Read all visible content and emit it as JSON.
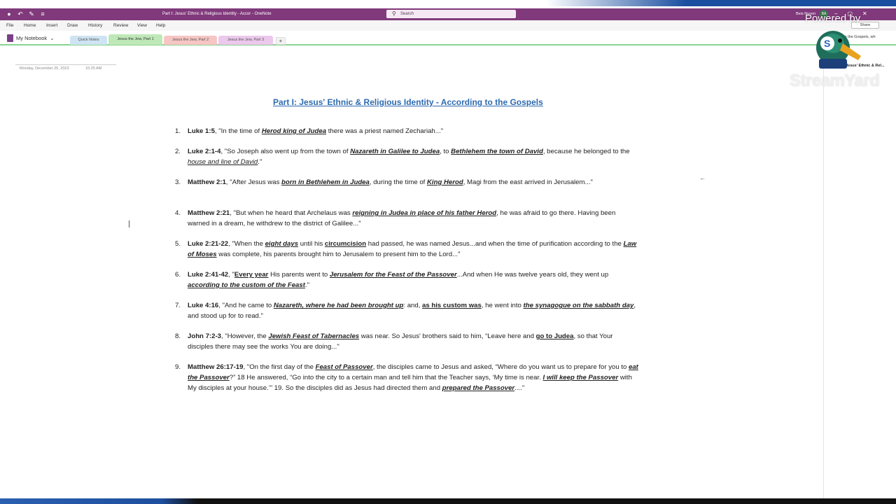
{
  "titlebar": {
    "title": "Part I: Jesus' Ethnic & Religious Identity - Accor  -  OneNote",
    "search_placeholder": "Search",
    "user_name": "Beis Nuvon",
    "user_initials": "BA"
  },
  "menu": [
    "File",
    "Home",
    "Insert",
    "Draw",
    "History",
    "Review",
    "View",
    "Help"
  ],
  "notebook": {
    "name": "My Notebook"
  },
  "section_tabs": [
    {
      "label": "Quick Notes",
      "color": "#cfe4f2"
    },
    {
      "label": "Jesus the Jew, Part 1",
      "color": "#bfe8b8"
    },
    {
      "label": "Jesus the Jew, Part 2",
      "color": "#f6c6c4"
    },
    {
      "label": "Jesus the Jew, Part 3",
      "color": "#ecc8ec"
    }
  ],
  "add_tab_label": "+",
  "page": {
    "date": "Monday, December 25, 2023",
    "time": "10:25 AM",
    "title": "Part I: Jesus' Ethnic & Religious Identity - According to the Gospels"
  },
  "entries": [
    {
      "num": "1.",
      "ref": "Luke 1:5",
      "t1": ", \"In the time of ",
      "e1": "Herod king of Judea",
      "t2": " there was a priest named Zechariah...\""
    },
    {
      "num": "2.",
      "ref": "Luke 2:1-4",
      "t1": ", \"So Joseph also went up from the town of ",
      "e1": "Nazareth in Galilee to Judea",
      "t2": ", to ",
      "e2": "Bethlehem the town of David",
      "t3": ", because he belonged to the ",
      "e3": "house and line of David",
      "t4": ".\""
    },
    {
      "num": "3.",
      "ref": "Matthew 2:1",
      "t1": ", \"After Jesus was ",
      "e1": "born in Bethlehem in Judea",
      "t2": ", during the time of ",
      "e2": "King Herod",
      "t3": ", Magi from the east arrived in Jerusalem...\""
    },
    {
      "num": "4.",
      "ref": "Matthew 2:21",
      "t1": ", \"But when he heard that Archelaus was ",
      "e1": "reigning in Judea in place of his father Herod",
      "t2": ", he was afraid to go there. Having been warned in a dream, he withdrew to the district of Galilee...\""
    },
    {
      "num": "5.",
      "ref": "Luke 2:21-22",
      "t1": ", \"When the ",
      "e1": "eight days",
      "t2": " until his ",
      "e2": "circumcision",
      "t3": " had passed, he was named Jesus...and when the time of purification according to the ",
      "e3": "Law of Moses",
      "t4": " was complete, his parents brought him to Jerusalem to present him to the Lord...\""
    },
    {
      "num": "6.",
      "ref": "Luke 2:41-42",
      "t1": ", \"",
      "e1": "Every year",
      "t2": " His parents went to ",
      "e2": "Jerusalem for the Feast of the Passover",
      "t3": "...And when He was twelve years old, they went up ",
      "e3": "according to the custom of the Feast",
      "t4": ".\""
    },
    {
      "num": "7.",
      "ref": "Luke 4:16",
      "t1": ", \"And he came to ",
      "e1": "Nazareth, where he had been brought up",
      "t2": ": and, ",
      "e2": "as his custom was",
      "t3": ", he went into ",
      "e3": "the synagogue on the sabbath day",
      "t4": ", and stood up for to read.\""
    },
    {
      "num": "8.",
      "ref": "John 7:2-3",
      "t1": ", \"However, the ",
      "e1": "Jewish Feast of Tabernacles",
      "t2": " was near. So Jesus' brothers said to him, “Leave here and ",
      "e2": "go to Judea",
      "t3": ", so that Your disciples there may see the works You are doing...\""
    },
    {
      "num": "9.",
      "ref": "Matthew 26:17-19",
      "t1": ", \"On the first day of the ",
      "e1": "Feast of Passover",
      "t2": ", the disciples came to Jesus and asked, “Where do you want us to prepare for you to ",
      "e2": "eat the Passover",
      "t3": "?” 18 He answered, “Go into the city to a certain man and tell him that the Teacher says, ‘My time is near. ",
      "e3": "I will keep the Passover",
      "t4": " with My disciples at your house.’” 19. So the disciples did as Jesus had directed them and ",
      "e4": "prepared the Passover",
      "t5": "....\""
    }
  ],
  "right_pane": {
    "share_label": "Share",
    "search_result": "to the Gospels, wh",
    "page_item": "Part I: Jesus' Ethnic & Rel..."
  },
  "overlay": {
    "powered_by": "Powered by",
    "brand": "StreamYard"
  },
  "colors": {
    "title_bar": "#80397b",
    "title_link": "#2d6ab0",
    "section_underline": "#87d48f"
  }
}
